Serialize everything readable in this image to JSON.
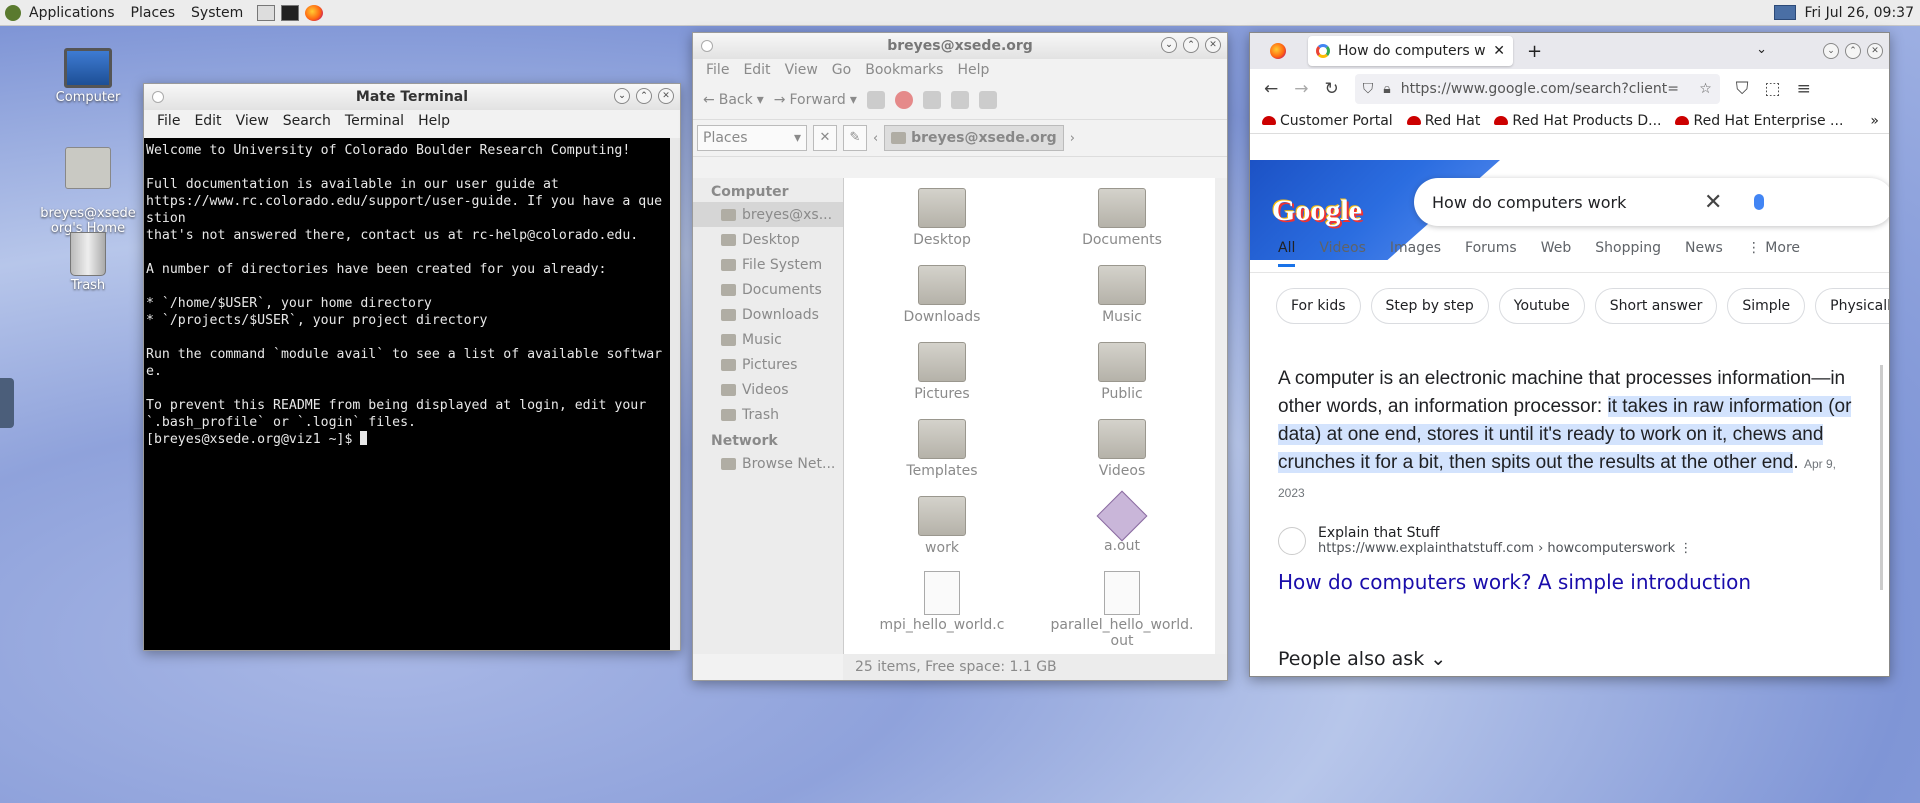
{
  "top_panel": {
    "menus": [
      "Applications",
      "Places",
      "System"
    ],
    "clock": "Fri Jul 26, 09:37"
  },
  "desktop": {
    "icons": [
      {
        "label": "Computer"
      },
      {
        "label": "breyes@xsede\norg's Home"
      },
      {
        "label": "Trash"
      }
    ]
  },
  "terminal": {
    "title": "Mate Terminal",
    "menu": [
      "File",
      "Edit",
      "View",
      "Search",
      "Terminal",
      "Help"
    ],
    "lines": [
      "Welcome to University of Colorado Boulder Research Computing!",
      "",
      "Full documentation is available in our user guide at",
      "https://www.rc.colorado.edu/support/user-guide. If you have a que",
      "stion",
      "that's not answered there, contact us at rc-help@colorado.edu.",
      "",
      "A number of directories have been created for you already:",
      "",
      "* `/home/$USER`, your home directory",
      "* `/projects/$USER`, your project directory",
      "",
      "Run the command `module avail` to see a list of available softwar",
      "e.",
      "",
      "To prevent this README from being displayed at login, edit your",
      "`.bash_profile` or `.login` files."
    ],
    "prompt": "[breyes@xsede.org@viz1 ~]$ "
  },
  "files": {
    "title": "breyes@xsede.org",
    "menu": [
      "File",
      "Edit",
      "View",
      "Go",
      "Bookmarks",
      "Help"
    ],
    "toolbar": {
      "back": "Back",
      "forward": "Forward"
    },
    "places_label": "Places",
    "breadcrumb": "breyes@xsede.org",
    "sidebar": {
      "computer_heading": "Computer",
      "computer_items": [
        "breyes@xs...",
        "Desktop",
        "File System",
        "Documents",
        "Downloads",
        "Music",
        "Pictures",
        "Videos",
        "Trash"
      ],
      "network_heading": "Network",
      "network_items": [
        "Browse Net..."
      ]
    },
    "items": [
      {
        "name": "Desktop",
        "kind": "folder"
      },
      {
        "name": "Documents",
        "kind": "folder"
      },
      {
        "name": "Downloads",
        "kind": "folder"
      },
      {
        "name": "Music",
        "kind": "folder"
      },
      {
        "name": "Pictures",
        "kind": "folder"
      },
      {
        "name": "Public",
        "kind": "folder"
      },
      {
        "name": "Templates",
        "kind": "folder"
      },
      {
        "name": "Videos",
        "kind": "folder"
      },
      {
        "name": "work",
        "kind": "folder"
      },
      {
        "name": "a.out",
        "kind": "exec"
      },
      {
        "name": "mpi_hello_world.c",
        "kind": "file"
      },
      {
        "name": "parallel_hello_world.\nout",
        "kind": "file"
      }
    ],
    "status": "25 items, Free space: 1.1 GB"
  },
  "browser": {
    "tab_title": "How do computers work",
    "url": "https://www.google.com/search?client=",
    "bookmarks": [
      "Customer Portal",
      "Red Hat",
      "Red Hat Products D...",
      "Red Hat Enterprise ..."
    ],
    "search_query": "How do computers work",
    "doodle_text": "Google",
    "search_tabs": [
      "All",
      "Videos",
      "Images",
      "Forums",
      "Web",
      "Shopping",
      "News",
      "More"
    ],
    "chips": [
      "For kids",
      "Step by step",
      "Youtube",
      "Short answer",
      "Simple",
      "Physically"
    ],
    "snippet_plain": "A computer is an electronic machine that processes information—in other words, an information processor: ",
    "snippet_highlight": "it takes in raw information (or data) at one end, stores it until it's ready to work on it, chews and crunches it for a bit, then spits out the results at the other end",
    "snippet_end": ".",
    "snippet_date": "Apr 9, 2023",
    "source_name": "Explain that Stuff",
    "source_url": "https://www.explainthatstuff.com › howcomputerswork",
    "result_title": "How do computers work? A simple introduction",
    "people_also_ask": "People also ask"
  }
}
